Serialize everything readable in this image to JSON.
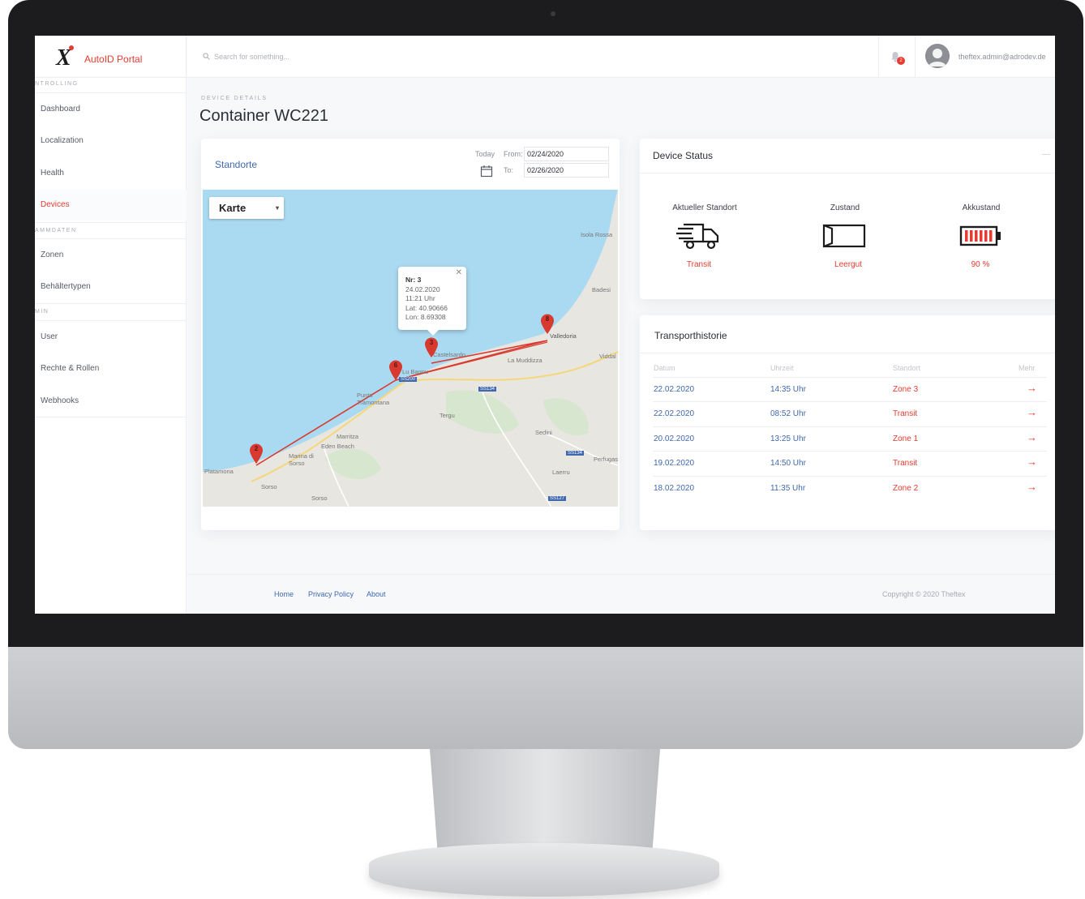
{
  "app": {
    "brand": "AutoID Portal"
  },
  "sidebar": {
    "sections": [
      "NTROLLING",
      "AMMDATEN",
      "MIN"
    ],
    "items": [
      {
        "label": "Dashboard"
      },
      {
        "label": "Localization"
      },
      {
        "label": "Health"
      },
      {
        "label": "Devices"
      },
      {
        "label": "Zonen"
      },
      {
        "label": "Behältertypen"
      },
      {
        "label": "User"
      },
      {
        "label": "Rechte & Rollen"
      },
      {
        "label": "Webhooks"
      }
    ]
  },
  "topbar": {
    "search_placeholder": "Search for something...",
    "notification_count": "2",
    "user_email": "theftex.admin@adrodev.de"
  },
  "page": {
    "breadcrumb": "DEVICE DETAILS",
    "title": "Container WC221"
  },
  "map_card": {
    "title": "Standorte",
    "today_label": "Today",
    "from_label": "From:",
    "from_value": "02/24/2020",
    "to_label": "To:",
    "to_value": "02/26/2020",
    "map_type": "Karte",
    "markers": [
      "2",
      "6",
      "3",
      "8"
    ],
    "popup": {
      "nr": "Nr: 3",
      "date": "24.02.2020",
      "time": "11:21 Uhr",
      "lat": "Lat: 40.90666",
      "lon": "Lon: 8.69308"
    },
    "place_labels": [
      "Isola Rossa",
      "Badesi",
      "Valledoria",
      "Viddal",
      "Castelsardo",
      "La Muddizza",
      "Lu Bagnu",
      "Punta Tramontana",
      "Tergu",
      "Sedini",
      "Marritza",
      "Eden Beach",
      "Marina di Sorso",
      "Platamona",
      "Sorso",
      "Sorso",
      "Laerru",
      "Perfugas"
    ],
    "road_labels": [
      "SS134",
      "SS200",
      "SS134",
      "SS127"
    ]
  },
  "status_card": {
    "title": "Device Status",
    "items": [
      {
        "title": "Aktueller Standort",
        "value": "Transit",
        "icon": "truck-icon"
      },
      {
        "title": "Zustand",
        "value": "Leergut",
        "icon": "container-icon"
      },
      {
        "title": "Akkustand",
        "value": "90 %",
        "icon": "battery-icon"
      }
    ]
  },
  "history_card": {
    "title": "Transporthistorie",
    "columns": [
      "Datum",
      "Uhrzeit",
      "Standort",
      "Mehr"
    ],
    "rows": [
      {
        "date": "22.02.2020",
        "time": "14:35 Uhr",
        "location": "Zone 3"
      },
      {
        "date": "22.02.2020",
        "time": "08:52 Uhr",
        "location": "Transit"
      },
      {
        "date": "20.02.2020",
        "time": "13:25 Uhr",
        "location": "Zone 1"
      },
      {
        "date": "19.02.2020",
        "time": "14:50 Uhr",
        "location": "Transit"
      },
      {
        "date": "18.02.2020",
        "time": "11:35 Uhr",
        "location": "Zone 2"
      }
    ]
  },
  "footer": {
    "links": [
      "Home",
      "Privacy Policy",
      "About"
    ],
    "copyright": "Copyright © 2020 Theftex"
  },
  "colors": {
    "accent": "#e53b30",
    "link": "#3f68ad",
    "water": "#aadaf2",
    "land": "#e8e6e1"
  }
}
